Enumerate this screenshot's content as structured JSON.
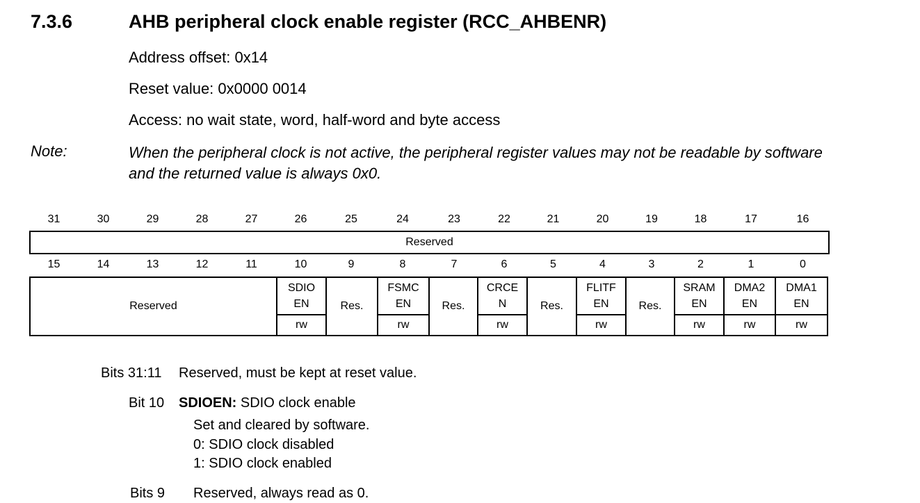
{
  "section": {
    "number": "7.3.6",
    "title": "AHB peripheral clock enable register (RCC_AHBENR)"
  },
  "meta": {
    "address_offset": "Address offset: 0x14",
    "reset_value": "Reset value: 0x0000 0014",
    "access": "Access: no wait state, word, half-word and byte access"
  },
  "note": {
    "label": "Note:",
    "text": "When the peripheral clock is not active, the peripheral register values may not be readable by software and the returned value is always 0x0."
  },
  "register": {
    "high_bits": [
      "31",
      "30",
      "29",
      "28",
      "27",
      "26",
      "25",
      "24",
      "23",
      "22",
      "21",
      "20",
      "19",
      "18",
      "17",
      "16"
    ],
    "high_field": "Reserved",
    "low_bits": [
      "15",
      "14",
      "13",
      "12",
      "11",
      "10",
      "9",
      "8",
      "7",
      "6",
      "5",
      "4",
      "3",
      "2",
      "1",
      "0"
    ],
    "low_fields": {
      "reserved": "Reserved",
      "sdioen": {
        "line1": "SDIO",
        "line2": "EN",
        "access": "rw"
      },
      "res9": "Res.",
      "fsmcen": {
        "line1": "FSMC",
        "line2": "EN",
        "access": "rw"
      },
      "res7": "Res.",
      "crcen": {
        "line1": "CRCE",
        "line2": "N",
        "access": "rw"
      },
      "res5": "Res.",
      "flitfen": {
        "line1": "FLITF",
        "line2": "EN",
        "access": "rw"
      },
      "res3": "Res.",
      "sramen": {
        "line1": "SRAM",
        "line2": "EN",
        "access": "rw"
      },
      "dma2en": {
        "line1": "DMA2",
        "line2": "EN",
        "access": "rw"
      },
      "dma1en": {
        "line1": "DMA1",
        "line2": "EN",
        "access": "rw"
      }
    }
  },
  "descriptions": {
    "bits_31_11": {
      "label": "Bits 31:11",
      "text": "Reserved, must be kept at reset value."
    },
    "bit_10": {
      "label": "Bit 10",
      "name": "SDIOEN:",
      "title": " SDIO clock enable",
      "lines": [
        "Set and cleared by software.",
        "0: SDIO clock disabled",
        "1: SDIO clock enabled"
      ]
    },
    "bits_9": {
      "label": "Bits 9",
      "text": "Reserved, always read as 0."
    }
  }
}
